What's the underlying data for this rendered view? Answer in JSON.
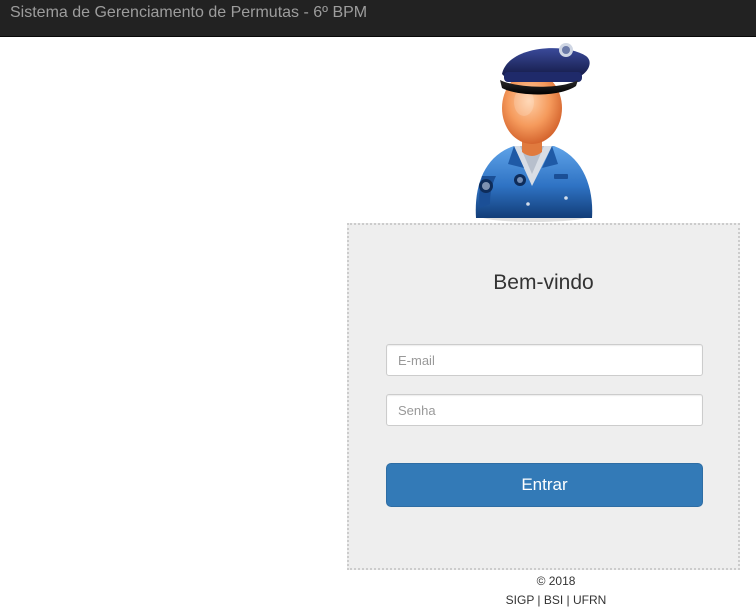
{
  "navbar": {
    "title": "Sistema de Gerenciamento de Permutas - 6º BPM"
  },
  "avatar": {
    "icon": "police-officer-icon"
  },
  "login": {
    "heading": "Bem-vindo",
    "email_placeholder": "E-mail",
    "email_value": "",
    "password_placeholder": "Senha",
    "password_value": "",
    "submit_label": "Entrar"
  },
  "footer": {
    "copyright": "© 2018",
    "credits": "SIGP | BSI | UFRN"
  },
  "colors": {
    "navbar_bg": "#222222",
    "navbar_text": "#9d9d9d",
    "panel_bg": "#eeeeee",
    "primary_button": "#337ab7"
  }
}
